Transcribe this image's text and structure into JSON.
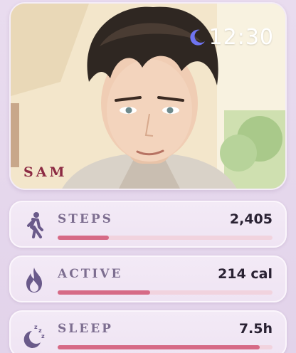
{
  "hero": {
    "name": "SAM",
    "time": "12:30",
    "moon_icon": "crescent-moon-icon"
  },
  "colors": {
    "accent": "#d66a86",
    "track": "#f1d3de",
    "icon": "#6a5a8a",
    "label": "#7d6e90",
    "name": "#8c2a43"
  },
  "stats": [
    {
      "label": "STEPS",
      "value": "2,405",
      "icon": "walking-person-icon",
      "progress": 0.24
    },
    {
      "label": "ACTIVE",
      "value": "214 cal",
      "icon": "flame-icon",
      "progress": 0.43
    },
    {
      "label": "SLEEP",
      "value": "7.5h",
      "icon": "moon-zzz-icon",
      "progress": 0.94
    }
  ]
}
